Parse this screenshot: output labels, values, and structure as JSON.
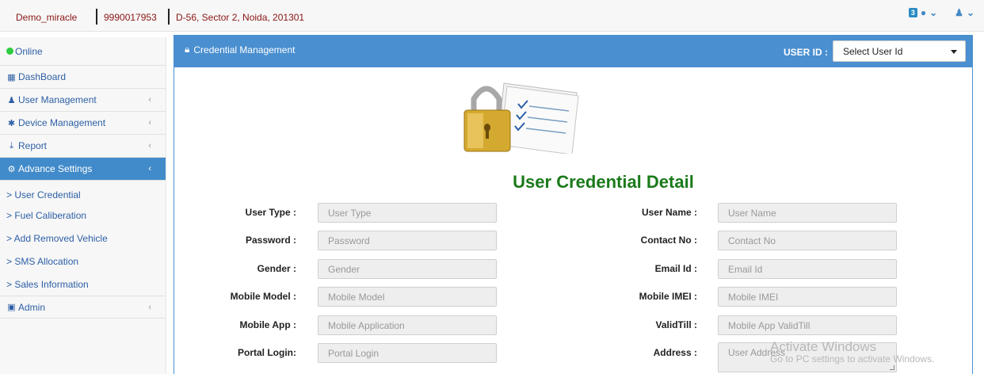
{
  "topbar": {
    "company": "Demo_miracle",
    "phone": "9990017953",
    "address": "D-56, Sector 2, Noida, 201301",
    "notification_count": "3",
    "icons": [
      "globe-icon",
      "chevron-down-icon",
      "user-icon",
      "chevron-down-icon"
    ]
  },
  "sidebar": {
    "status": "Online",
    "items": [
      {
        "label": "DashBoard",
        "icon": "table-icon",
        "chevron": false
      },
      {
        "label": "User Management",
        "icon": "user-icon",
        "chevron": true
      },
      {
        "label": "Device Management",
        "icon": "asterisk-icon",
        "chevron": true
      },
      {
        "label": "Report",
        "icon": "download-icon",
        "chevron": true
      },
      {
        "label": "Advance Settings",
        "icon": "gear-icon",
        "chevron": true,
        "active": true
      }
    ],
    "subitems": [
      "> User Credential",
      "> Fuel Caliberation",
      "> Add Removed Vehicle",
      "> SMS Allocation",
      "> Sales Information"
    ],
    "admin": {
      "label": "Admin",
      "icon": "briefcase-icon"
    }
  },
  "panel": {
    "title": "Credential Management",
    "user_id_label": "USER ID :",
    "user_id_select": "Select User Id",
    "heading": "User Credential Detail"
  },
  "form": {
    "left": [
      {
        "label": "User Type :",
        "placeholder": "User Type"
      },
      {
        "label": "Password :",
        "placeholder": "Password"
      },
      {
        "label": "Gender :",
        "placeholder": "Gender"
      },
      {
        "label": "Mobile Model :",
        "placeholder": "Mobile Model"
      },
      {
        "label": "Mobile App :",
        "placeholder": "Mobile Application"
      },
      {
        "label": "Portal Login:",
        "placeholder": "Portal Login"
      }
    ],
    "right": [
      {
        "label": "User Name :",
        "placeholder": "User Name"
      },
      {
        "label": "Contact No :",
        "placeholder": "Contact No"
      },
      {
        "label": "Email Id :",
        "placeholder": "Email Id"
      },
      {
        "label": "Mobile IMEI :",
        "placeholder": "Mobile IMEI"
      },
      {
        "label": "ValidTill :",
        "placeholder": "Mobile App ValidTill"
      },
      {
        "label": "Address :",
        "placeholder": "User Address"
      }
    ]
  },
  "watermark": {
    "title": "Activate Windows",
    "subtitle": "Go to PC settings to activate Windows."
  },
  "colors": {
    "accent": "#428bca",
    "heading": "#1a7a1a",
    "topbar_text": "#8a1515"
  }
}
